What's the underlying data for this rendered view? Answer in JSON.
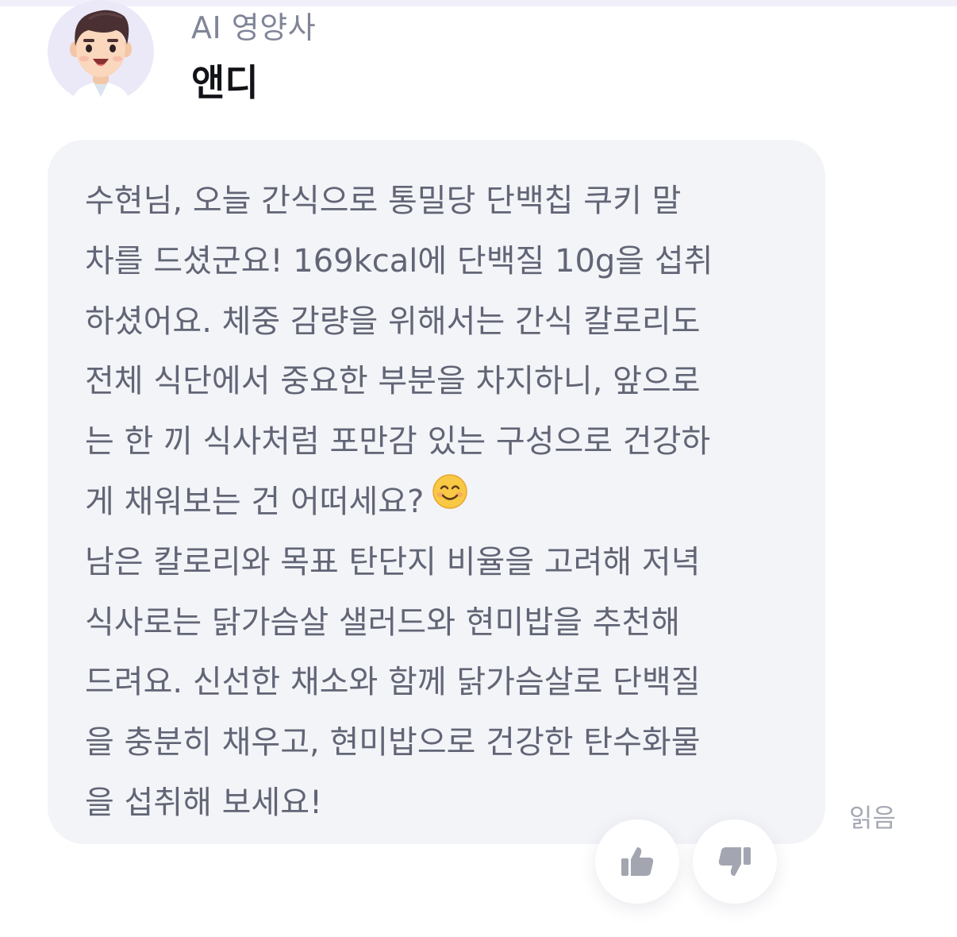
{
  "header": {
    "role": "AI 영양사",
    "name": "앤디"
  },
  "avatar": {
    "icon": "doctor-avatar-icon",
    "background": "#ebe9f8"
  },
  "message": {
    "lines": [
      "수현님, 오늘 간식으로 통밀당 단백칩 쿠키 말",
      "차를 드셨군요! 169kcal에 단백질 10g을 섭취",
      "하셨어요. 체중 감량을 위해서는 간식 칼로리도",
      "전체 식단에서 중요한 부분을 차지하니, 앞으로",
      "는 한 끼 식사처럼 포만감 있는 구성으로 건강하",
      "게 채워보는 건 어떠세요?",
      "남은 칼로리와 목표 탄단지 비율을 고려해 저녁",
      "식사로는 닭가슴살 샐러드와 현미밥을 추천해",
      "드려요. 신선한 채소와 함께 닭가슴살로 단백질",
      "을 충분히 채우고, 현미밥으로 건강한 탄수화물",
      "을 섭취해 보세요!"
    ],
    "emoji_icon": "smiling-face-emoji-icon",
    "bubble_color": "#f3f4f8",
    "text_color": "#616575"
  },
  "status": {
    "read": "읽음"
  },
  "feedback": {
    "like_icon": "thumbs-up-icon",
    "dislike_icon": "thumbs-down-icon",
    "icon_color": "#a3a6b0"
  }
}
